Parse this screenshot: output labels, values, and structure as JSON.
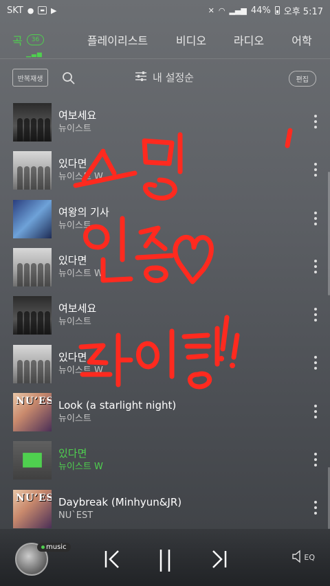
{
  "status_bar": {
    "carrier": "SKT",
    "battery": "44%",
    "time": "오후 5:17"
  },
  "tabs": [
    {
      "label": "곡",
      "count": "36"
    },
    {
      "label": "플레이리스트"
    },
    {
      "label": "비디오"
    },
    {
      "label": "라디오"
    },
    {
      "label": "어학"
    }
  ],
  "toolbar": {
    "repeat_label": "반복재생",
    "sort_label": "내 설정순",
    "edit_label": "편집"
  },
  "songs": [
    {
      "title": "여보세요",
      "artist": "뉴이스트",
      "art": "dark",
      "playing": false
    },
    {
      "title": "있다면",
      "artist": "뉴이스트 W",
      "art": "light",
      "playing": false
    },
    {
      "title": "여왕의 기사",
      "artist": "뉴이스트",
      "art": "blue",
      "playing": false
    },
    {
      "title": "있다면",
      "artist": "뉴이스트 W",
      "art": "light",
      "playing": false
    },
    {
      "title": "여보세요",
      "artist": "뉴이스트",
      "art": "dark",
      "playing": false
    },
    {
      "title": "있다면",
      "artist": "뉴이스트 W",
      "art": "light",
      "playing": false
    },
    {
      "title": "Look (a starlight night)",
      "artist": "뉴이스트",
      "art": "nuest",
      "playing": false
    },
    {
      "title": "있다면",
      "artist": "뉴이스트 W",
      "art": "playing",
      "playing": true
    },
    {
      "title": "Daybreak (Minhyun&JR)",
      "artist": "NU`EST",
      "art": "nuest",
      "playing": false
    }
  ],
  "player": {
    "badge": "music",
    "eq_label": "EQ"
  },
  "colors": {
    "accent": "#4fd04f",
    "handwriting": "#ff2a1f"
  }
}
